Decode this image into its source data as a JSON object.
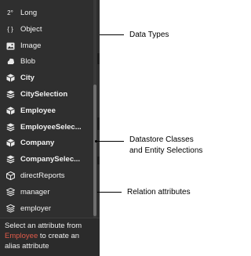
{
  "attributes": [
    {
      "prefix": "2°",
      "label": "Long",
      "icon": "number-icon",
      "bold": false
    },
    {
      "prefix": "{ }",
      "label": "Object",
      "icon": "object-icon",
      "bold": false
    },
    {
      "label": "Image",
      "icon": "image-icon",
      "bold": false
    },
    {
      "label": "Blob",
      "icon": "blob-icon",
      "bold": false
    },
    {
      "label": "City",
      "icon": "dataclass-icon",
      "bold": true
    },
    {
      "label": "CitySelection",
      "icon": "entity-selection-icon",
      "bold": true
    },
    {
      "label": "Employee",
      "icon": "dataclass-icon",
      "bold": true
    },
    {
      "label": "EmployeeSelec...",
      "icon": "entity-selection-icon",
      "bold": true
    },
    {
      "label": "Company",
      "icon": "dataclass-icon",
      "bold": true
    },
    {
      "label": "CompanySelec...",
      "icon": "entity-selection-icon",
      "bold": true
    },
    {
      "label": "directReports",
      "icon": "relation-many-icon",
      "bold": false
    },
    {
      "label": "manager",
      "icon": "relation-one-icon",
      "bold": false
    },
    {
      "label": "employer",
      "icon": "relation-one-icon",
      "bold": false
    }
  ],
  "tooltip": {
    "line1": "Select an attribute from",
    "highlight": "Employee",
    "line2_rest": " to create an",
    "line3": "alias attribute"
  },
  "annotations": {
    "data_types": "Data Types",
    "datastore_line1": "Datastore Classes",
    "datastore_line2": "and Entity Selections",
    "relation": "Relation attributes"
  }
}
